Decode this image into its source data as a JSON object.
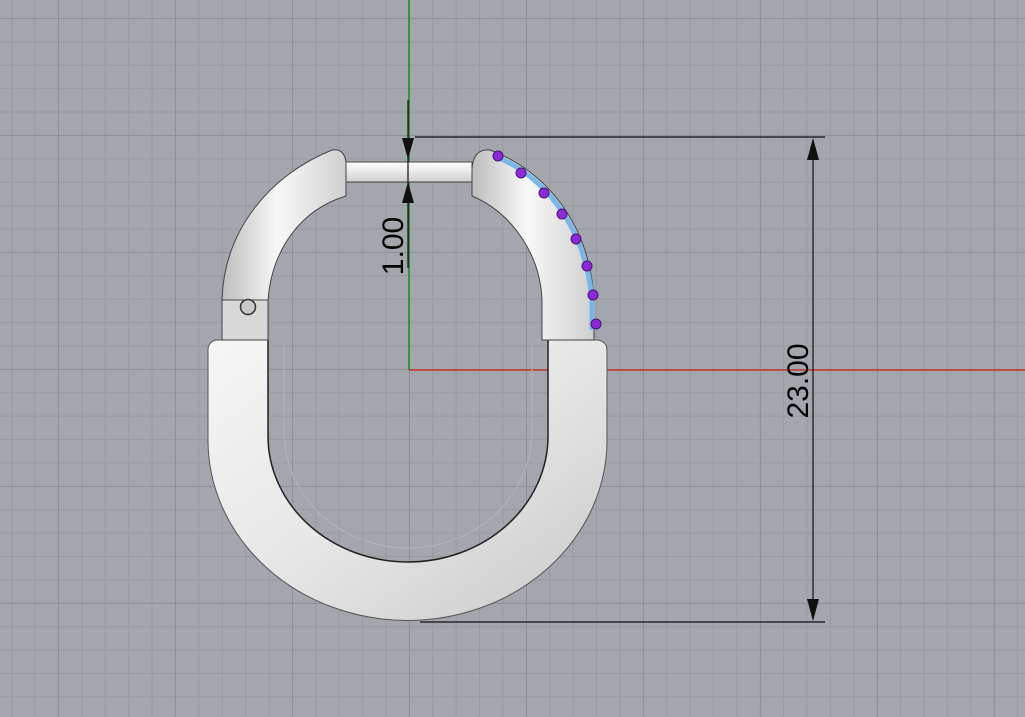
{
  "viewport": {
    "background_color": "#a3a6ac",
    "grid_color": "#8e9196",
    "x_axis_color": "#c0392b",
    "y_axis_color": "#1e8a1e"
  },
  "model": {
    "object": "hoop-earring",
    "body_color": "#e9e9e9",
    "gem_color": "#8a2bd6",
    "seat_color": "#7ab6e8"
  },
  "dimensions": {
    "height_label": "23.00",
    "gap_label": "1.00"
  }
}
